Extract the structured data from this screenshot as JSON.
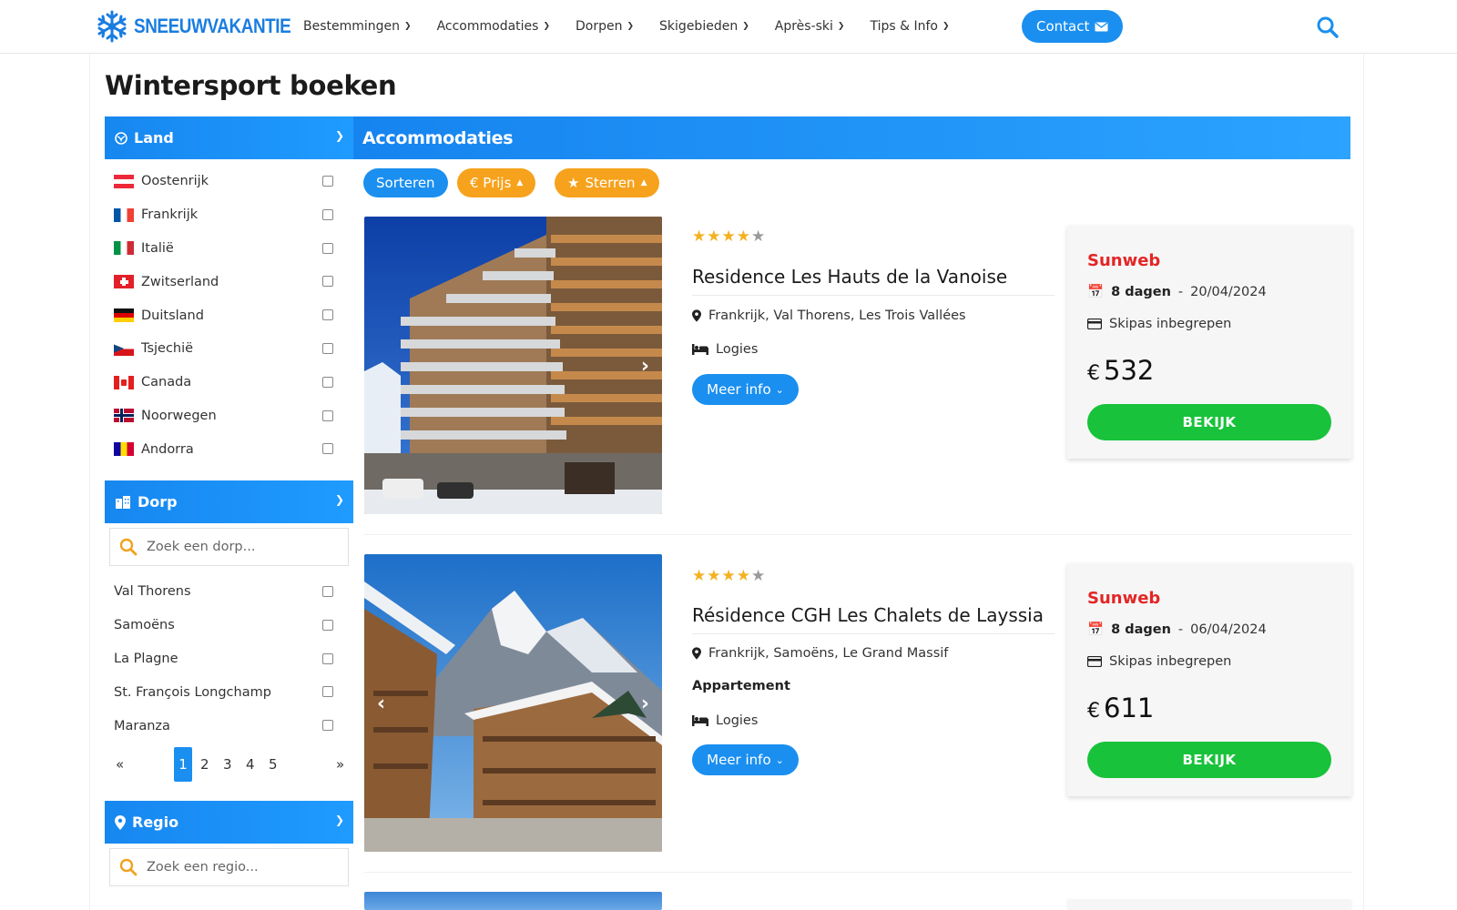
{
  "header": {
    "logo_text": "SNEEUWVAKANTIE",
    "nav": [
      {
        "label": "Bestemmingen"
      },
      {
        "label": "Accommodaties"
      },
      {
        "label": "Dorpen"
      },
      {
        "label": "Skigebieden"
      },
      {
        "label": "Après-ski"
      },
      {
        "label": "Tips & Info"
      }
    ],
    "contact_label": "Contact",
    "icons": {
      "search": "search-icon",
      "logo": "snowflake-icon",
      "contact": "envelope-icon"
    },
    "colors": {
      "brand": "#1a7de0",
      "accent": "#1a8ff0"
    }
  },
  "page_title": "Wintersport boeken",
  "sidebar": {
    "land": {
      "title": "Land",
      "items": [
        {
          "label": "Oostenrijk"
        },
        {
          "label": "Frankrijk"
        },
        {
          "label": "Italië"
        },
        {
          "label": "Zwitserland"
        },
        {
          "label": "Duitsland"
        },
        {
          "label": "Tsjechië"
        },
        {
          "label": "Canada"
        },
        {
          "label": "Noorwegen"
        },
        {
          "label": "Andorra"
        }
      ]
    },
    "dorp": {
      "title": "Dorp",
      "search_placeholder": "Zoek een dorp...",
      "items": [
        {
          "label": "Val Thorens"
        },
        {
          "label": "Samoëns"
        },
        {
          "label": "La Plagne"
        },
        {
          "label": "St. François Longchamp"
        },
        {
          "label": "Maranza"
        }
      ],
      "pager": {
        "prev": "«",
        "pages": [
          "1",
          "2",
          "3",
          "4",
          "5"
        ],
        "current": "1",
        "next": "»"
      }
    },
    "regio": {
      "title": "Regio",
      "search_placeholder": "Zoek een regio..."
    }
  },
  "main": {
    "title": "Accommodaties",
    "sort": {
      "label": "Sorteren",
      "price_label": "€ Prijs",
      "stars_label": "Sterren"
    },
    "cards": [
      {
        "rating": 4,
        "rating_max": 5,
        "name": "Residence Les Hauts de la Vanoise",
        "location": "Frankrijk, Val Thorens, Les Trois Vallées",
        "board": "Logies",
        "more_label": "Meer info",
        "provider": "Sunweb",
        "duration": "8 dagen",
        "date": "20/04/2024",
        "skipass": "Skipas inbegrepen",
        "currency": "€",
        "price": "532",
        "cta": "BEKIJK"
      },
      {
        "rating": 4,
        "rating_max": 5,
        "name": "Résidence CGH Les Chalets de Layssia",
        "location": "Frankrijk, Samoëns, Le Grand Massif",
        "type": "Appartement",
        "board": "Logies",
        "more_label": "Meer info",
        "provider": "Sunweb",
        "duration": "8 dagen",
        "date": "06/04/2024",
        "skipass": "Skipas inbegrepen",
        "currency": "€",
        "price": "611",
        "cta": "BEKIJK"
      }
    ]
  }
}
